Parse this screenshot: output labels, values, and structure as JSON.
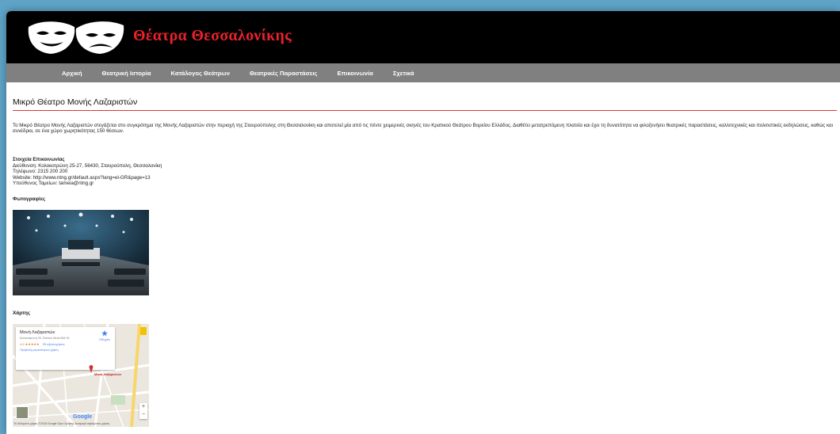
{
  "site": {
    "title": "Θέατρα Θεσσαλονίκης"
  },
  "nav": {
    "items": [
      "Αρχική",
      "Θεατρική Ιστορία",
      "Κατάλογος Θεάτρων",
      "Θεατρικές Παραστάσεις",
      "Επικοινωνία",
      "Σχετικά"
    ]
  },
  "page": {
    "title": "Μικρό Θέατρο Μονής Λαζαριστών",
    "description": "Το Μικρό Θέατρο Μονής Λαζαριστών στεγάζεται στο συγκρότημα της Μονής Λαζαριστών στην περιοχή της Σταυρούπολης στη Θεσσαλονίκη και αποτελεί μία από τις πέντε χειμερινές σκηνές του Κρατικού Θεάτρου Βορείου Ελλάδος. Διαθέτει μετατρεπόμενη πλατεία και έχει τη δυνατότητα να φιλοξενήσει θεατρικές παραστάσεις, καλλιτεχνικές και πολιτιστικές εκδηλώσεις, καθώς και συνέδρια, σε ένα χώρο χωρητικότητας 150 θέσεων."
  },
  "contact": {
    "heading": "Στοιχεία Επικοινωνίας",
    "address": "Διεύθυνση: Κολοκοτρώνη 25-27, 56430, Σταυρούπολη, Θεσσαλονίκη",
    "phone": "Τηλέφωνο: 2315 200 200",
    "website": "Website: http://www.ntng.gr/default.aspx?lang=el-GR&page=13",
    "email": "Υπεύθυνος Ταμείων: tameia@ntng.gr"
  },
  "sections": {
    "photos": "Φωτογραφίες",
    "map": "Χάρτης"
  },
  "map": {
    "place_name": "Μονή Λαζαριστών",
    "place_address": "Κολοκοτρώνη 25, Παύλου Μελά 564 30",
    "rating": "4,6 ★★★★★",
    "reviews": "39 αξιολογήσεις",
    "bigger_map": "Προβολή μεγαλύτερου χάρτη",
    "directions": "Οδηγίες",
    "marker_label": "Μονή Λαζαριστών",
    "footer": "Τα δεδομένα χάρτη ©2018 Google   Όροι Χρήσης   Αναφορά σφάλματος χάρτη",
    "google": "Google"
  }
}
